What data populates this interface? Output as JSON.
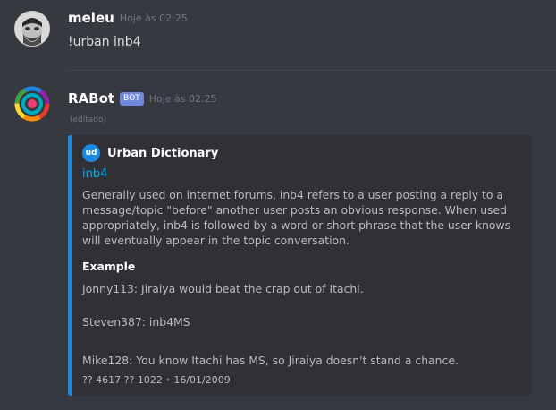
{
  "messages": [
    {
      "author": "meleu",
      "timestamp": "Hoje às 02:25",
      "content": "!urban inb4"
    },
    {
      "author": "RABot",
      "bot_tag": "BOT",
      "timestamp": "Hoje às 02:25",
      "edited": "(editado)",
      "embed": {
        "author": "Urban Dictionary",
        "author_icon_text": "ud",
        "title": "inb4",
        "description": "Generally used on internet forums, inb4 refers to a user posting a reply to a message/topic \"before\" another user posts an obvious response. When used appropriately, inb4 is followed by a word or short phrase that the user knows will eventually appear in the topic conversation.",
        "field_name": "Example",
        "field_lines": [
          "Jonny113: Jiraiya would beat the crap out of Itachi.",
          "Steven387: inb4MS",
          "Mike128: You know Itachi has MS, so Jiraiya doesn't stand a chance."
        ],
        "footer": {
          "votes": "?? 4617 ?? 1022",
          "separator": "•",
          "date": "16/01/2009"
        },
        "accent_color": "#1d8ae0"
      }
    }
  ],
  "colors": {
    "background": "#36393f",
    "embed_background": "#2f3136",
    "link": "#00b0f4",
    "bot_tag": "#7289da"
  }
}
